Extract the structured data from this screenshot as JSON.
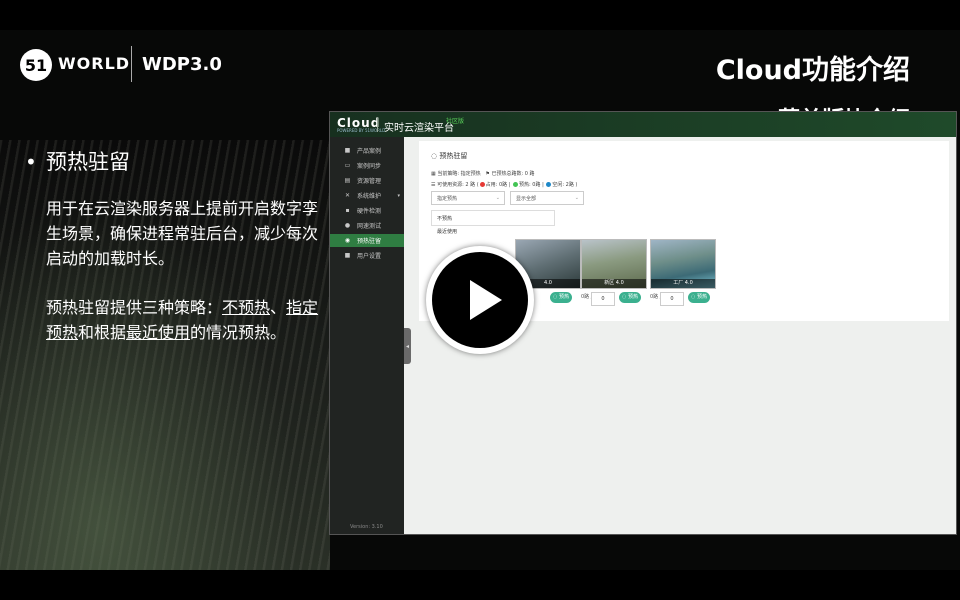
{
  "header": {
    "logo_51": "51",
    "logo_world": "WORLD",
    "logo_wdp": "WDP3.0",
    "title": "Cloud功能介绍",
    "subtitle": "菜单版块介绍"
  },
  "content": {
    "bullet_title": "预热驻留",
    "para1": "用于在云渲染服务器上提前开启数字孪生场景，确保进程常驻后台，减少每次启动的加载时长。",
    "para2_a": "预热驻留提供三种策略：",
    "strategy1": "不预热",
    "sep1": "、",
    "strategy2": "指定预热",
    "para2_b": "和根据",
    "strategy3": "最近使用",
    "para2_c": "的情况预热。"
  },
  "app": {
    "logo": "Cloud",
    "logo_sub": "POWERED BY 51WORLD",
    "platform": "实时云渲染平台",
    "community": "社区版",
    "version": "Version: 3.10",
    "sidebar": [
      {
        "label": "产品案例",
        "icon": "bookmark-icon"
      },
      {
        "label": "案例同步",
        "icon": "monitor-icon"
      },
      {
        "label": "资源管理",
        "icon": "folder-icon"
      },
      {
        "label": "系统维护",
        "icon": "tools-icon"
      },
      {
        "label": "硬件检测",
        "icon": "check-icon"
      },
      {
        "label": "网速测试",
        "icon": "gauge-icon"
      },
      {
        "label": "预热驻留",
        "icon": "power-icon"
      },
      {
        "label": "用户设置",
        "icon": "user-icon"
      }
    ],
    "active_index": 6,
    "page_title": "预热驻留",
    "info1_a": "当前策略: 指定预热",
    "info1_b": "已预热总路数: 0 路",
    "info2_prefix": "可使用资源: 2 路 (",
    "info2_occupied": "占用: 0路",
    "info2_preheat": "预热: 0路",
    "info2_free": "空闲: 2路 )",
    "select1": "指定预热",
    "select2": "显示全部",
    "dropdown_opt1": "不预热",
    "dropdown_opt2": "最近使用",
    "thumbs": [
      {
        "caption": "4.0"
      },
      {
        "caption": "新区 4.0"
      },
      {
        "caption": "工厂 4.0"
      }
    ],
    "row_label": "0路 /",
    "qty": "0",
    "preheat_btn": "预热",
    "colors": {
      "occupied": "#e53935",
      "preheat": "#43c454",
      "free": "#1e88c8",
      "accent": "#2f7d42"
    }
  }
}
